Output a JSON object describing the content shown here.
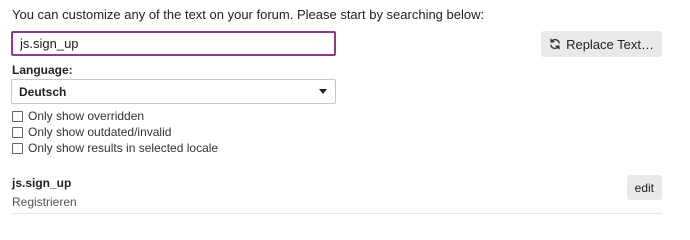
{
  "intro_text": "You can customize any of the text on your forum. Please start by searching below:",
  "search": {
    "value": "js.sign_up"
  },
  "replace_button": {
    "icon": "sync-icon",
    "label": "Replace Text…"
  },
  "language": {
    "label": "Language:",
    "selected": "Deutsch"
  },
  "filters": [
    {
      "label": "Only show overridden",
      "checked": false
    },
    {
      "label": "Only show outdated/invalid",
      "checked": false
    },
    {
      "label": "Only show results in selected locale",
      "checked": false
    }
  ],
  "result": {
    "key": "js.sign_up",
    "value": "Registrieren",
    "edit_label": "edit"
  },
  "colors": {
    "input_focus_border": "#8e3b8f",
    "button_bg": "#e9e9e9"
  }
}
